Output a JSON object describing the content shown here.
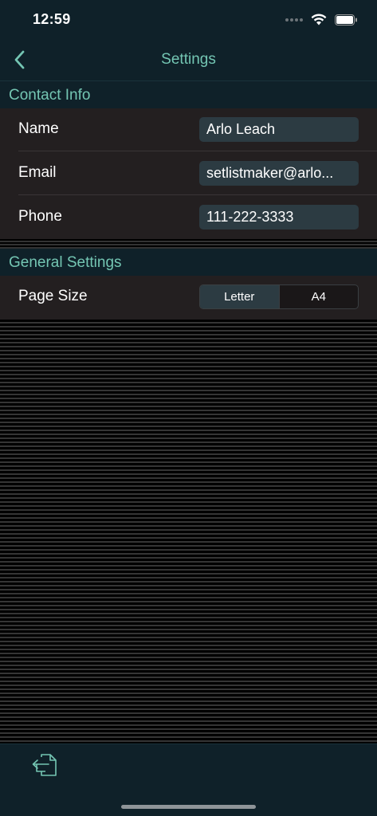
{
  "status_bar": {
    "time": "12:59"
  },
  "nav": {
    "title": "Settings",
    "back_icon": "chevron-left-icon"
  },
  "contact_info": {
    "header": "Contact Info",
    "rows": [
      {
        "label": "Name",
        "value": "Arlo Leach"
      },
      {
        "label": "Email",
        "value": "setlistmaker@arlo..."
      },
      {
        "label": "Phone",
        "value": "111-222-3333"
      }
    ]
  },
  "general_settings": {
    "header": "General Settings",
    "page_size": {
      "label": "Page Size",
      "options": [
        "Letter",
        "A4"
      ],
      "selected": "Letter"
    }
  },
  "toolbar": {
    "export_icon": "export-document-icon"
  },
  "colors": {
    "accent": "#74c6b3",
    "background": "#0f2129",
    "group_background": "#231f20",
    "field_background": "#2c3b42"
  }
}
